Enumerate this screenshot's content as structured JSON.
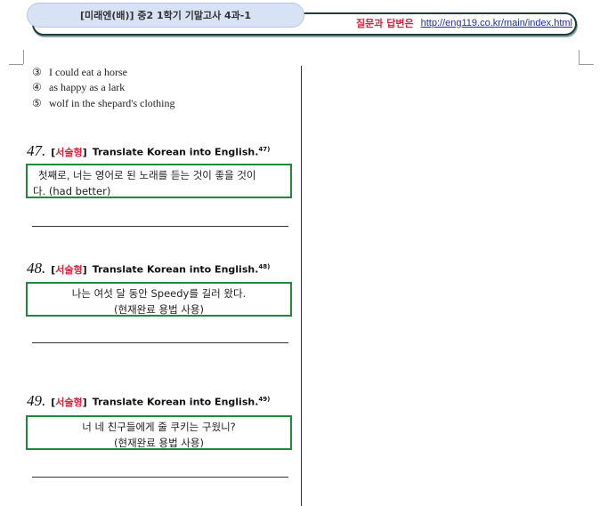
{
  "header": {
    "tag": "[미래엔(배)] 중2 1학기 기말고사 4과-1",
    "qa_label": "질문과 답변은",
    "qa_url": "http://eng119.co.kr/main/index.html"
  },
  "options": [
    {
      "num": "③",
      "text": "I could eat a horse"
    },
    {
      "num": "④",
      "text": "as happy as a lark"
    },
    {
      "num": "⑤",
      "text": "wolf in the shepard's clothing"
    }
  ],
  "questions": [
    {
      "num": "47.",
      "type_open": "[",
      "type": "서술형",
      "type_close": "]",
      "title": "Translate Korean into English.",
      "footnote": "47)",
      "line1": "첫째로, 너는 영어로 된 노래를 듣는 것이 좋을 것이",
      "line2": "다. (had better)"
    },
    {
      "num": "48.",
      "type_open": "[",
      "type": "서술형",
      "type_close": "]",
      "title": "Translate Korean into English.",
      "footnote": "48)",
      "line1": "나는 여섯 달 동안 Speedy를 길러 왔다.",
      "line2": "(현재완료 용법 사용)"
    },
    {
      "num": "49.",
      "type_open": "[",
      "type": "서술형",
      "type_close": "]",
      "title": "Translate Korean into English.",
      "footnote": "49)",
      "line1": "너 네 친구들에게 줄 쿠키는 구웠니?",
      "line2": "(현재완료 용법 사용)"
    }
  ]
}
